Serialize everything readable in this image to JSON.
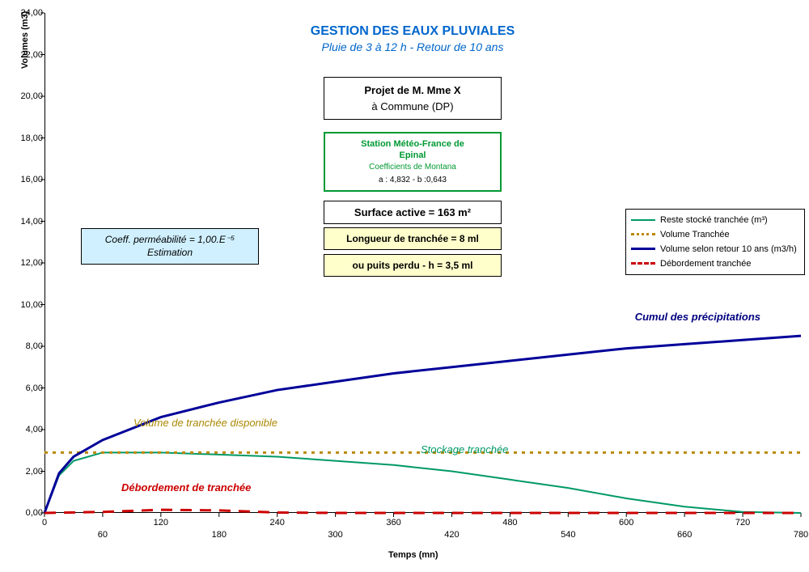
{
  "chart_data": {
    "type": "line",
    "title": "GESTION DES EAUX PLUVIALES",
    "subtitle": "Pluie de 3 à 12 h - Retour de 10 ans",
    "xlabel": "Temps (mn)",
    "ylabel": "Volumes (m3)",
    "xlim": [
      0,
      780
    ],
    "ylim": [
      0,
      24
    ],
    "x_ticks": [
      0,
      60,
      120,
      180,
      240,
      300,
      360,
      420,
      480,
      540,
      600,
      660,
      720,
      780
    ],
    "y_ticks": [
      0,
      2,
      4,
      6,
      8,
      10,
      12,
      14,
      16,
      18,
      20,
      22,
      24
    ],
    "series": [
      {
        "name": "Reste stocké tranchée (m³)",
        "color": "#009966",
        "style": "solid",
        "x": [
          0,
          15,
          30,
          60,
          120,
          180,
          240,
          300,
          360,
          420,
          480,
          540,
          600,
          660,
          720,
          780
        ],
        "y": [
          0.0,
          1.8,
          2.5,
          2.9,
          2.9,
          2.8,
          2.7,
          2.5,
          2.3,
          2.0,
          1.6,
          1.2,
          0.7,
          0.3,
          0.05,
          0.0
        ]
      },
      {
        "name": "Volume Tranchée",
        "color": "#bb8800",
        "style": "dotted",
        "x": [
          0,
          780
        ],
        "y": [
          2.9,
          2.9
        ]
      },
      {
        "name": "Volume selon retour 10 ans (m3/h)",
        "color": "#000099",
        "style": "solid",
        "x": [
          0,
          15,
          30,
          60,
          120,
          180,
          240,
          300,
          360,
          420,
          480,
          540,
          600,
          660,
          720,
          780
        ],
        "y": [
          0.0,
          1.9,
          2.7,
          3.5,
          4.6,
          5.3,
          5.9,
          6.3,
          6.7,
          7.0,
          7.3,
          7.6,
          7.9,
          8.1,
          8.3,
          8.5
        ]
      },
      {
        "name": "Débordement tranchée",
        "color": "#cc0000",
        "style": "dashed",
        "x": [
          0,
          60,
          120,
          180,
          240,
          300,
          780
        ],
        "y": [
          0.0,
          0.05,
          0.15,
          0.12,
          0.02,
          0.0,
          0.0
        ]
      }
    ],
    "annotations": [
      {
        "text": "Cumul des précipitations",
        "color": "#000080"
      },
      {
        "text": "Volume de tranchée disponible",
        "color": "#aa8800"
      },
      {
        "text": "Stockage tranchée",
        "color": "#009966"
      },
      {
        "text": "Débordement de tranchée",
        "color": "#cc0000"
      }
    ]
  },
  "legend": {
    "items": [
      {
        "label": "Reste stocké tranchée (m³)"
      },
      {
        "label": "Volume Tranchée"
      },
      {
        "label": "Volume selon retour 10 ans (m3/h)"
      },
      {
        "label": "Débordement tranchée"
      }
    ]
  },
  "info_boxes": {
    "projet_l1": "Projet de M. Mme X",
    "projet_l2": "à Commune (DP)",
    "station_l1": "Station Météo-France de",
    "station_l2": "Epinal",
    "station_l3": "Coefficients de Montana",
    "station_l4": "a : 4,832 - b :0,643",
    "surface": "Surface active = 163 m²",
    "longueur": "Longueur de tranchée = 8 ml",
    "puits": "ou puits perdu - h = 3,5 ml",
    "perm_l1": "Coeff. perméabilité = 1,00.E⁻⁵",
    "perm_l2": "Estimation"
  },
  "y_tick_labels": [
    "0,00",
    "2,00",
    "4,00",
    "6,00",
    "8,00",
    "10,00",
    "12,00",
    "14,00",
    "16,00",
    "18,00",
    "20,00",
    "22,00",
    "24,00"
  ],
  "x_tick_labels": [
    "0",
    "60",
    "120",
    "180",
    "240",
    "300",
    "360",
    "420",
    "480",
    "540",
    "600",
    "660",
    "720",
    "780"
  ],
  "annot": {
    "cumul": "Cumul des précipitations",
    "voltranch": "Volume de tranchée disponible",
    "stock": "Stockage tranchée",
    "debord": "Débordement de tranchée"
  }
}
